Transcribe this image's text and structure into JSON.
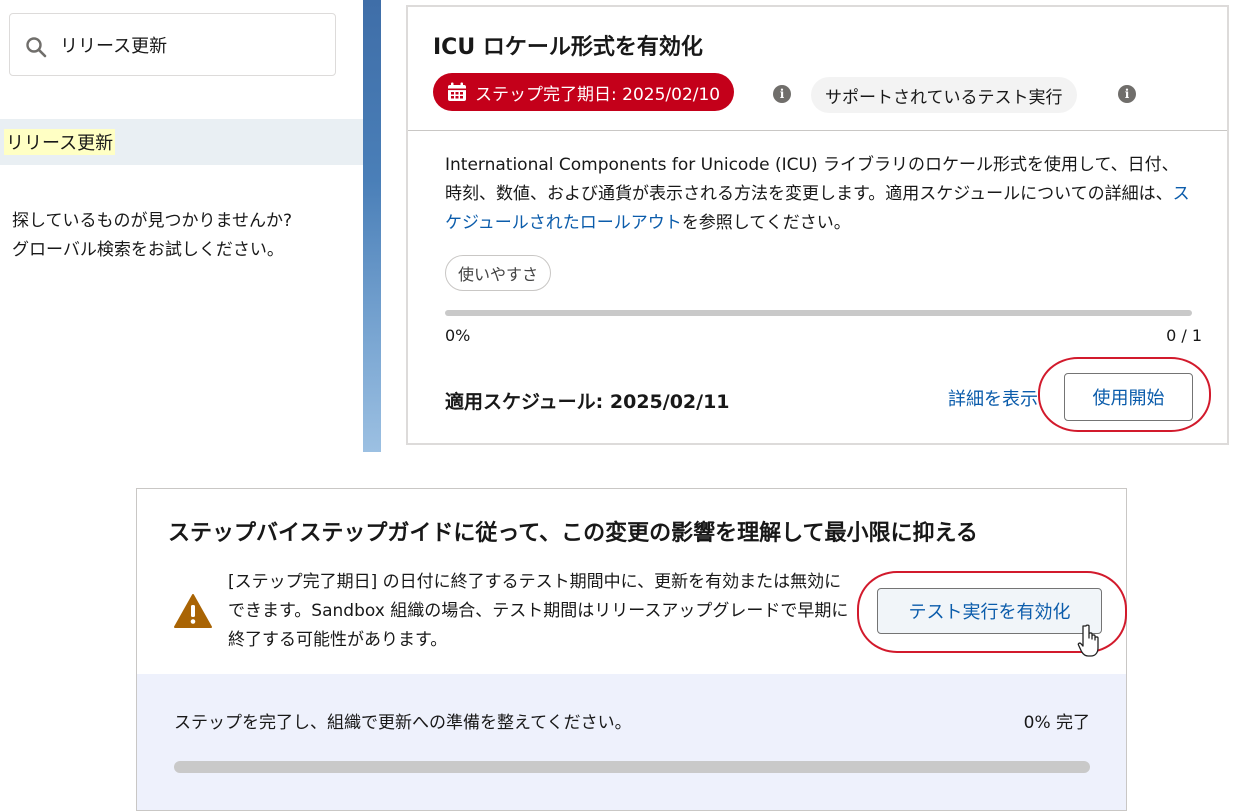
{
  "search": {
    "value": "リリース更新",
    "icon": "search-icon"
  },
  "results": {
    "item_label": "リリース更新"
  },
  "not_found": {
    "line1": "探しているものが見つかりませんか?",
    "line2": "グローバル検索をお試しください。"
  },
  "release_card": {
    "title": "ICU ロケール形式を有効化",
    "due_badge": "ステップ完了期日: 2025/02/10",
    "supported_badge": "サポートされているテスト実行",
    "description": {
      "part1": "International Components for Unicode (ICU) ライブラリのロケール形式を使用して、日付、時刻、数値、および通貨が表示される方法を変更します。適用スケジュールについての詳細は、",
      "link": "スケジュールされたロールアウト",
      "part2": "を参照してください。"
    },
    "tag": "使いやすさ",
    "progress": {
      "percent_label": "0%",
      "count_label": "0 / 1",
      "fraction": 0
    },
    "schedule": "適用スケジュール: 2025/02/11",
    "details_link": "詳細を表示",
    "start_button": "使用開始"
  },
  "guide_card": {
    "title": "ステップバイステップガイドに従って、この変更の影響を理解して最小限に抑える",
    "warning_text": "[ステップ完了期日] の日付に終了するテスト期間中に、更新を有効または無効にできます。Sandbox 組織の場合、テスト期間はリリースアップグレードで早期に終了する可能性があります。",
    "enable_button": "テスト実行を有効化",
    "footer_text": "ステップを完了し、組織で更新への準備を整えてください。",
    "footer_percent": "0% 完了",
    "progress_fraction": 0
  },
  "colors": {
    "accent_red": "#c4001a",
    "link_blue": "#0b5cab",
    "annotation_red": "#d21a2c",
    "warning_orange": "#a96404"
  }
}
